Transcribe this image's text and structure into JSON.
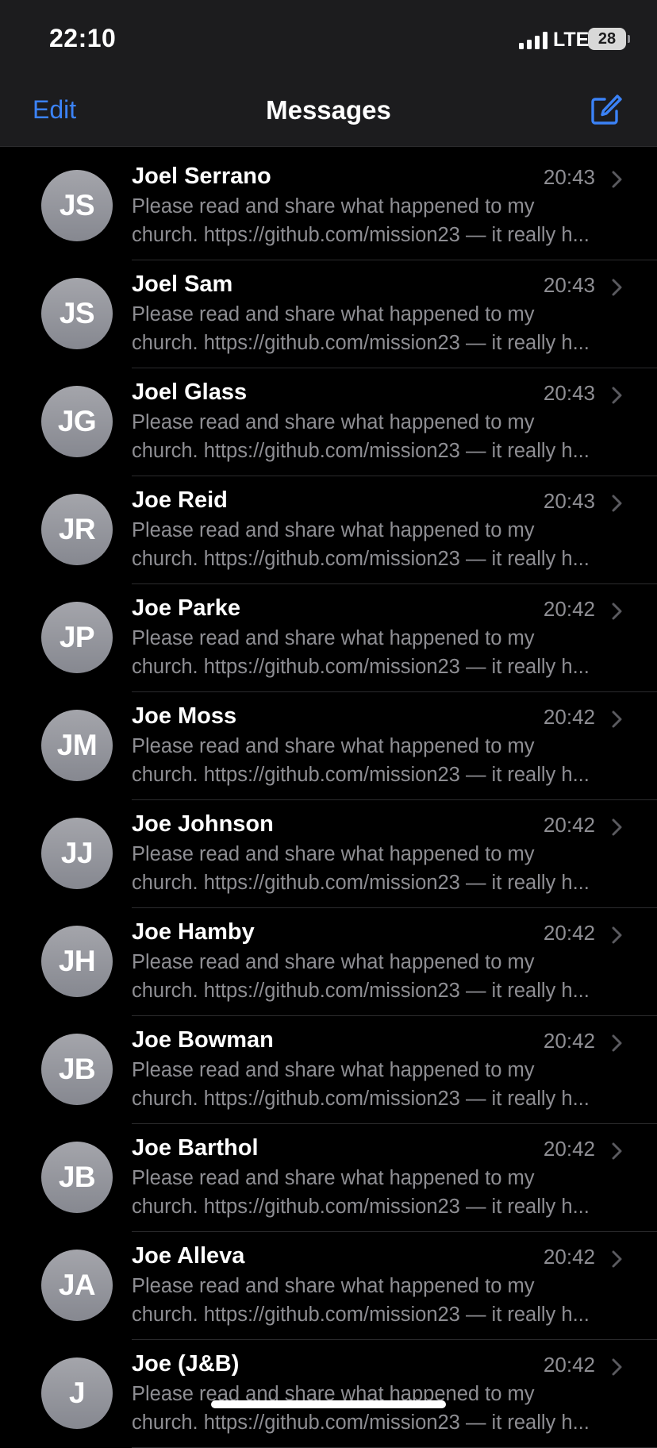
{
  "status": {
    "time": "22:10",
    "network": "LTE",
    "battery": "28"
  },
  "nav": {
    "edit_label": "Edit",
    "title": "Messages"
  },
  "colors": {
    "accent": "#3b82f6",
    "background": "#000000",
    "secondary_text": "#8e8e93"
  },
  "conversations": [
    {
      "initials": "JS",
      "name": "Joel Serrano",
      "time": "20:43",
      "preview_line1": "Please read and share what happened to my",
      "preview_line2": "church. https://github.com/mission23 — it really h..."
    },
    {
      "initials": "JS",
      "name": "Joel Sam",
      "time": "20:43",
      "preview_line1": "Please read and share what happened to my",
      "preview_line2": "church. https://github.com/mission23 — it really h..."
    },
    {
      "initials": "JG",
      "name": "Joel Glass",
      "time": "20:43",
      "preview_line1": "Please read and share what happened to my",
      "preview_line2": "church. https://github.com/mission23 — it really h..."
    },
    {
      "initials": "JR",
      "name": "Joe Reid",
      "time": "20:43",
      "preview_line1": "Please read and share what happened to my",
      "preview_line2": "church. https://github.com/mission23 — it really h..."
    },
    {
      "initials": "JP",
      "name": "Joe Parke",
      "time": "20:42",
      "preview_line1": "Please read and share what happened to my",
      "preview_line2": "church. https://github.com/mission23 — it really h..."
    },
    {
      "initials": "JM",
      "name": "Joe Moss",
      "time": "20:42",
      "preview_line1": "Please read and share what happened to my",
      "preview_line2": "church. https://github.com/mission23 — it really h..."
    },
    {
      "initials": "JJ",
      "name": "Joe Johnson",
      "time": "20:42",
      "preview_line1": "Please read and share what happened to my",
      "preview_line2": "church. https://github.com/mission23 — it really h..."
    },
    {
      "initials": "JH",
      "name": "Joe Hamby",
      "time": "20:42",
      "preview_line1": "Please read and share what happened to my",
      "preview_line2": "church. https://github.com/mission23 — it really h..."
    },
    {
      "initials": "JB",
      "name": "Joe Bowman",
      "time": "20:42",
      "preview_line1": "Please read and share what happened to my",
      "preview_line2": "church. https://github.com/mission23 — it really h..."
    },
    {
      "initials": "JB",
      "name": "Joe Barthol",
      "time": "20:42",
      "preview_line1": "Please read and share what happened to my",
      "preview_line2": "church. https://github.com/mission23 — it really h..."
    },
    {
      "initials": "JA",
      "name": "Joe Alleva",
      "time": "20:42",
      "preview_line1": "Please read and share what happened to my",
      "preview_line2": "church. https://github.com/mission23 — it really h..."
    },
    {
      "initials": "J",
      "name": "Joe (J&B)",
      "time": "20:42",
      "preview_line1": "Please read and share what happened to my",
      "preview_line2": "church. https://github.com/mission23 — it really h..."
    }
  ]
}
